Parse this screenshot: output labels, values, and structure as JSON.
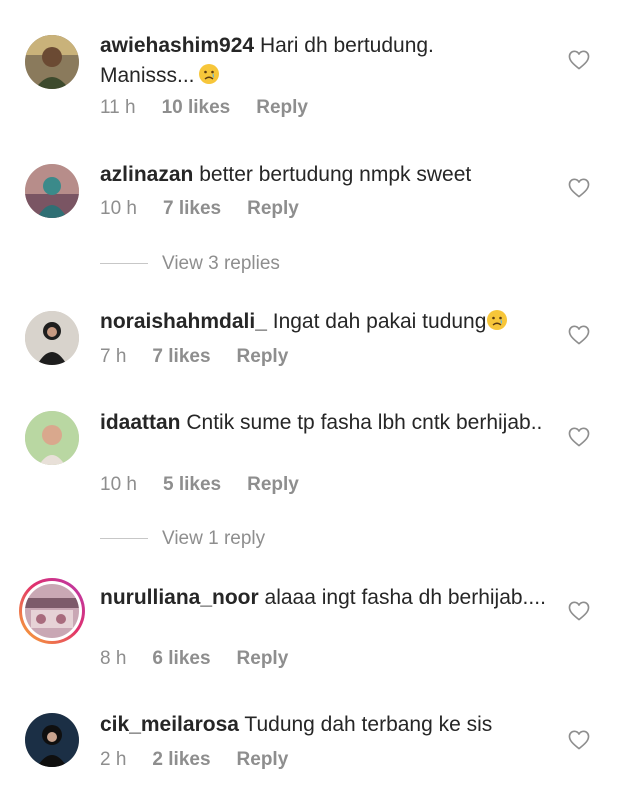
{
  "comments": [
    {
      "username": "awiehashim924",
      "text": "Hari dh bertudung.\nManisss...",
      "emoji": "sad-face-emoji",
      "time": "11 h",
      "likes": "10 likes",
      "reply": "Reply"
    },
    {
      "username": "azlinazan",
      "text": "better bertudung nmpk sweet",
      "time": "10 h",
      "likes": "7 likes",
      "reply": "Reply",
      "view_replies": "View 3 replies"
    },
    {
      "username": "noraishahmdali_",
      "text": "Ingat dah pakai tudung",
      "emoji": "sad-face-emoji",
      "time": "7 h",
      "likes": "7 likes",
      "reply": "Reply"
    },
    {
      "username": "idaattan",
      "text": "Cntik sume tp fasha lbh cntk berhijab..",
      "time": "10 h",
      "likes": "5 likes",
      "reply": "Reply",
      "view_replies": "View 1 reply"
    },
    {
      "username": "nurulliana_noor",
      "text": "alaaa ingt fasha dh berhijab....",
      "time": "8 h",
      "likes": "6 likes",
      "reply": "Reply"
    },
    {
      "username": "cik_meilarosa",
      "text": "Tudung dah terbang ke sis",
      "time": "2 h",
      "likes": "2 likes",
      "reply": "Reply"
    }
  ],
  "icons": {
    "like": "heart-outline-icon",
    "avatar": "avatar"
  },
  "colors": {
    "text": "#262626",
    "secondary": "#8e8e8e",
    "divider": "#c7c7c7",
    "story_ring_start": "#f9b031",
    "story_ring_end": "#b53ab0"
  }
}
